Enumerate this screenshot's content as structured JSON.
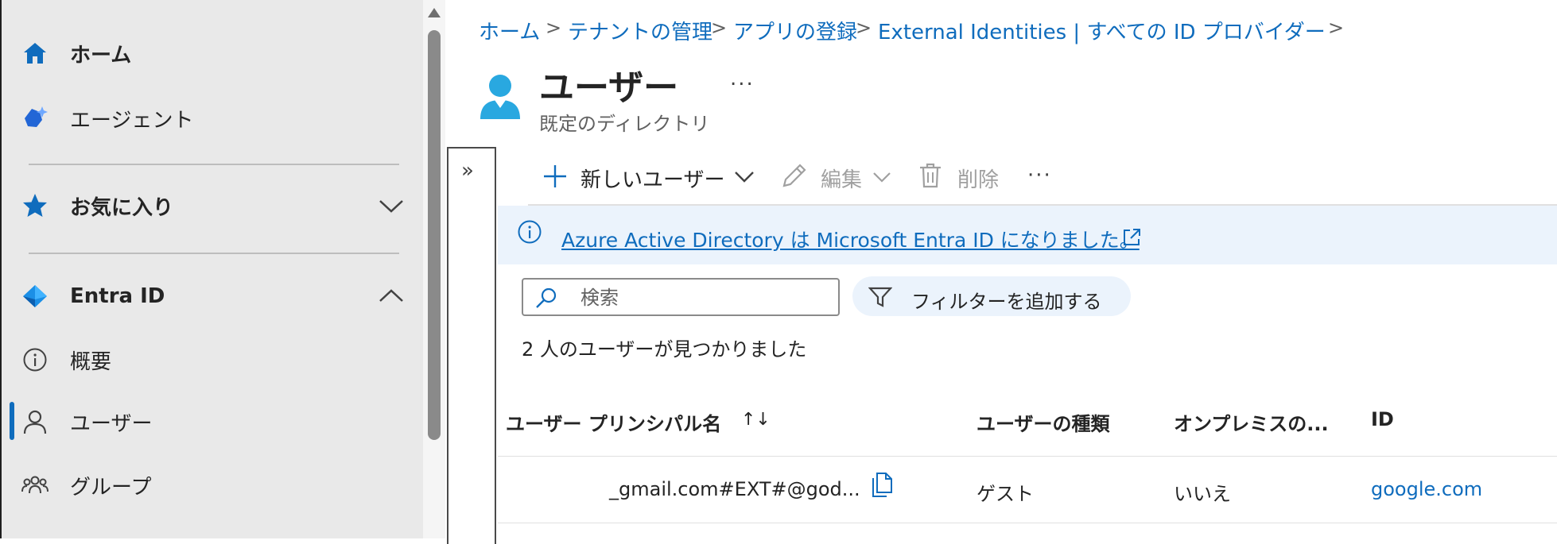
{
  "nav": {
    "home": "ホーム",
    "agents": "エージェント",
    "favorites": "お気に入り",
    "entra": "Entra ID",
    "overview": "概要",
    "users": "ユーザー",
    "groups": "グループ"
  },
  "breadcrumb": {
    "items": [
      "ホーム",
      "テナントの管理",
      "アプリの登録",
      "External Identities | すべての ID プロバイダー"
    ],
    "separator": ">"
  },
  "page": {
    "title": "ユーザー",
    "subtitle": "既定のディレクトリ",
    "more": "..."
  },
  "commands": {
    "new_user": "新しいユーザー",
    "edit": "編集",
    "delete": "削除",
    "more": "···"
  },
  "banner": {
    "text": "Azure Active Directory は Microsoft Entra ID になりました。"
  },
  "search": {
    "placeholder": "検索",
    "filter_label": "フィルターを追加する"
  },
  "results": {
    "count_text": "2 人のユーザーが見つかりました"
  },
  "table": {
    "headers": {
      "upn": "ユーザー プリンシパル名",
      "sort_glyph": "↑↓",
      "type": "ユーザーの種類",
      "onprem": "オンプレミスの...",
      "id": "ID"
    },
    "rows": [
      {
        "upn": "_gmail.com#EXT#@god...",
        "type": "ゲスト",
        "onprem": "いいえ",
        "id": "google.com"
      }
    ]
  },
  "colors": {
    "accent": "#0f6cbd",
    "nav_bg": "#e9e9e9",
    "banner_bg": "#ebf3fc"
  },
  "icons": {
    "home": "home-icon",
    "agents": "agent-icon",
    "favorites": "star-icon",
    "entra": "entra-diamond-icon",
    "overview": "info-icon",
    "users": "person-icon",
    "groups": "people-icon",
    "copy": "copy-icon",
    "external": "external-link-icon"
  }
}
